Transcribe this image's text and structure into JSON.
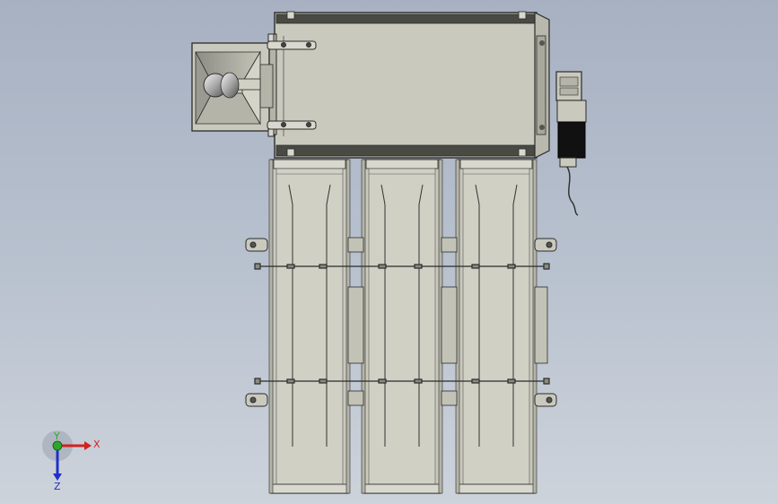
{
  "viewport": {
    "background_top": "#a7b1c2",
    "background_bottom": "#cdd3db"
  },
  "model": {
    "part_fill": "#c9c9bd",
    "edge_color": "#2b2b2b",
    "motor_color": "#111111",
    "conveyor_module_count": 3
  },
  "triad": {
    "x_label": "X",
    "y_label": "Y",
    "z_label": "Z",
    "x_color": "#d42020",
    "y_color": "#2aa82a",
    "z_color": "#2030c8"
  }
}
